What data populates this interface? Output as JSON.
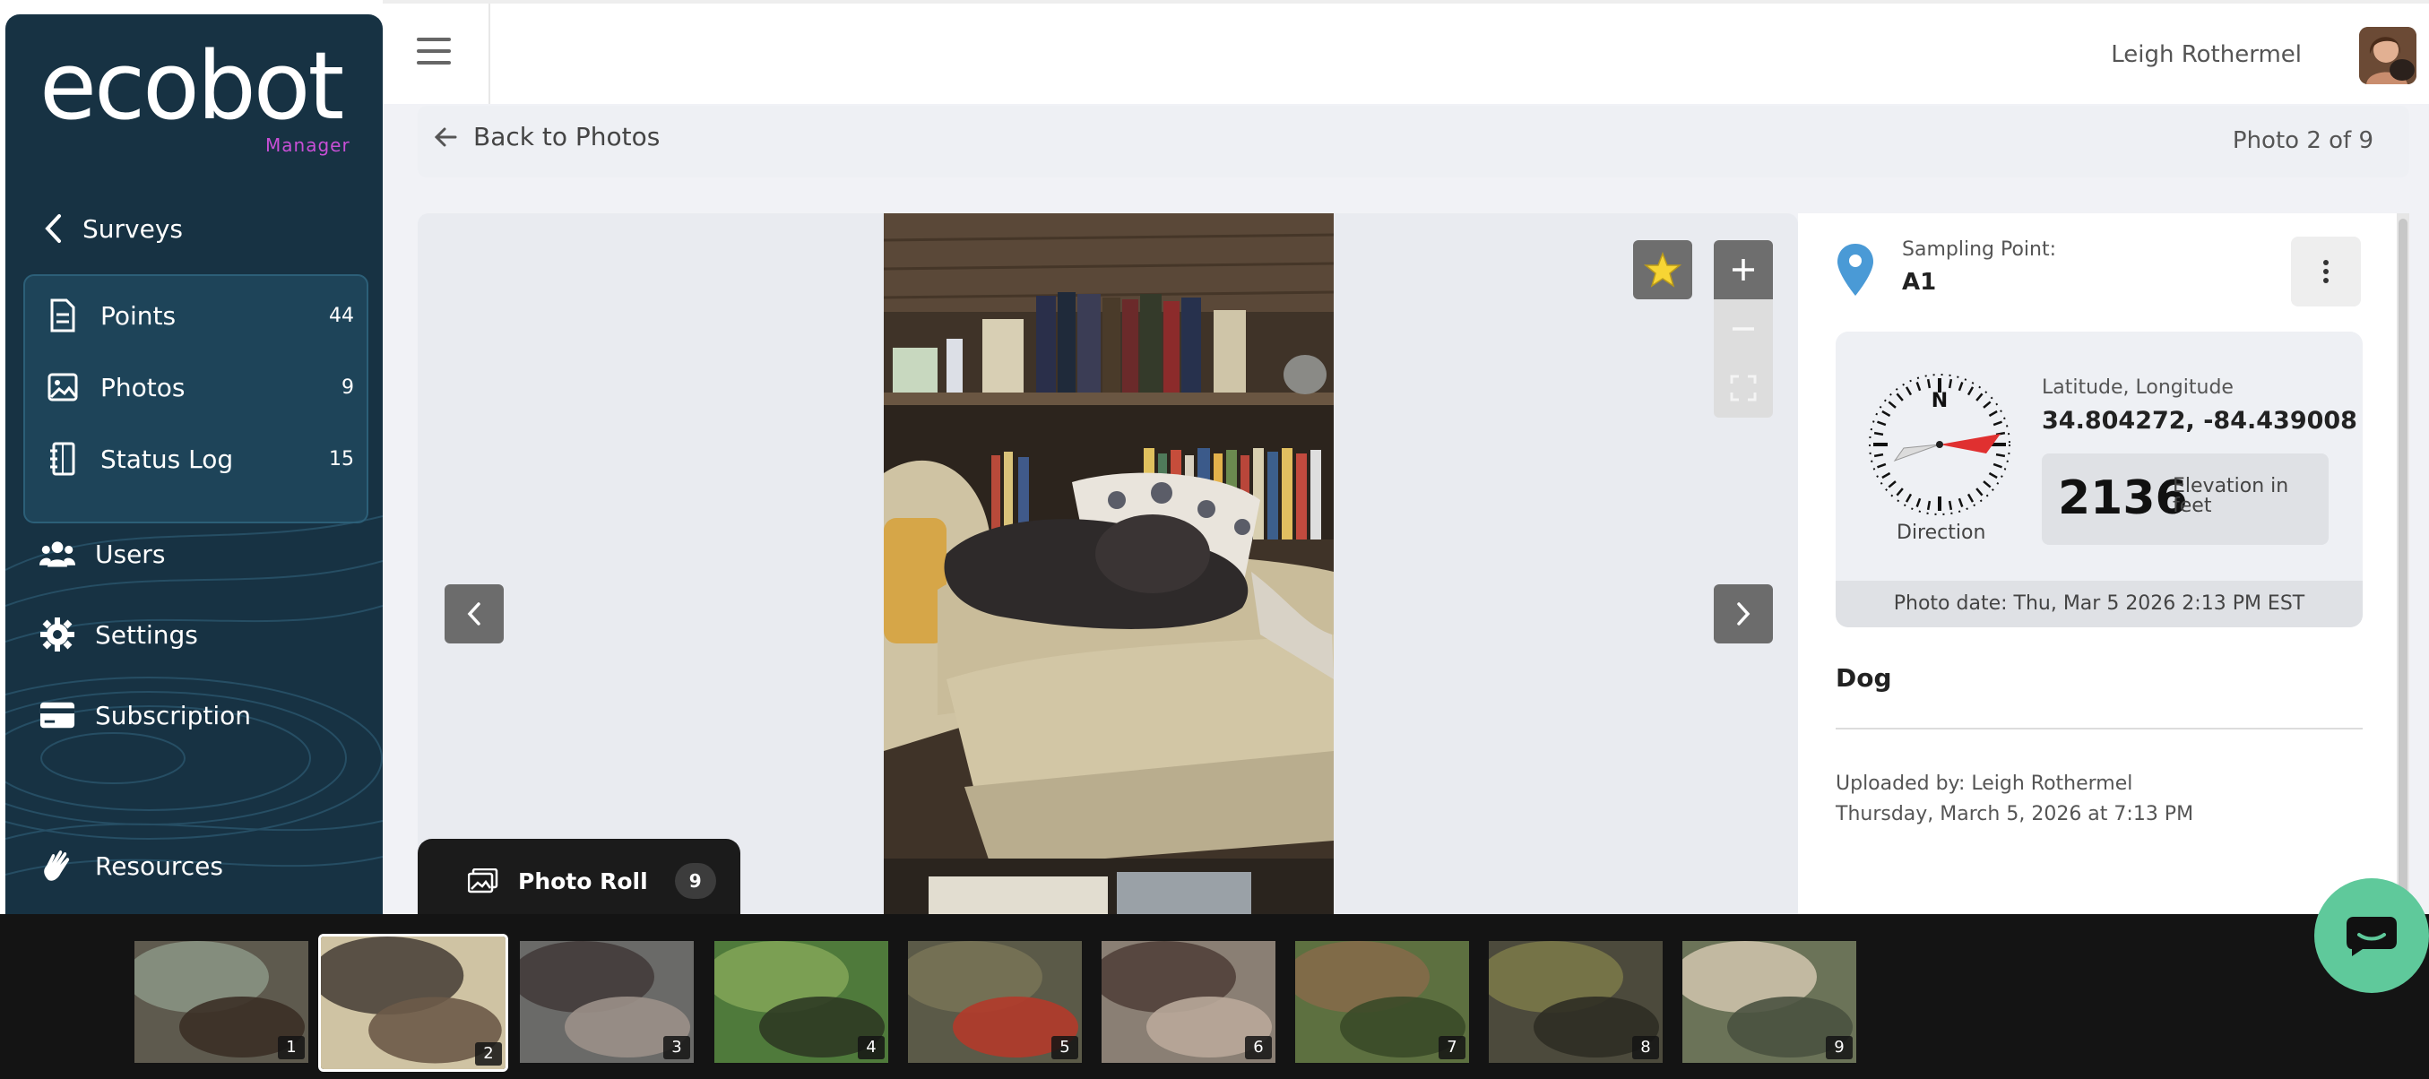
{
  "app": {
    "logo_text": "ecobot",
    "logo_sub": "Manager",
    "brand_color": "#173243",
    "accent_color": "#c84fd6"
  },
  "sidebar": {
    "back_label": "Surveys",
    "group_items": [
      {
        "label": "Points",
        "count": "44",
        "icon": "document-icon"
      },
      {
        "label": "Photos",
        "count": "9",
        "icon": "image-icon"
      },
      {
        "label": "Status Log",
        "count": "15",
        "icon": "log-icon"
      }
    ],
    "items": [
      {
        "label": "Users",
        "icon": "users-icon"
      },
      {
        "label": "Settings",
        "icon": "gear-icon"
      },
      {
        "label": "Subscription",
        "icon": "credit-card-icon"
      },
      {
        "label": "Resources",
        "icon": "hand-wave-icon"
      }
    ]
  },
  "header": {
    "user_name": "Leigh Rothermel"
  },
  "photo_nav": {
    "back_label": "Back to Photos",
    "position": "Photo 2 of 9"
  },
  "details": {
    "sampling_point_label": "Sampling Point:",
    "sampling_point_value": "A1",
    "direction_label": "Direction",
    "compass_n": "N",
    "latlng_label": "Latitude, Longitude",
    "latlng_value": "34.804272, -84.439008",
    "elevation_value": "2136",
    "elevation_label": "Elevation in feet",
    "photo_date": "Photo date: Thu, Mar 5 2026 2:13 PM EST",
    "caption": "Dog",
    "uploaded_by": "Uploaded by: Leigh Rothermel",
    "uploaded_at": "Thursday, March 5, 2026 at 7:13 PM"
  },
  "photo_roll": {
    "label": "Photo Roll",
    "count": "9",
    "thumbnails": [
      {
        "num": "1",
        "scene": "porch"
      },
      {
        "num": "2",
        "scene": "dog-on-couch"
      },
      {
        "num": "3",
        "scene": "dog-closeup"
      },
      {
        "num": "4",
        "scene": "plants"
      },
      {
        "num": "5",
        "scene": "ground-red-object"
      },
      {
        "num": "6",
        "scene": "dog-in-bed"
      },
      {
        "num": "7",
        "scene": "dog-standing"
      },
      {
        "num": "8",
        "scene": "brush"
      },
      {
        "num": "9",
        "scene": "dog-running"
      }
    ],
    "active_index": 1
  }
}
